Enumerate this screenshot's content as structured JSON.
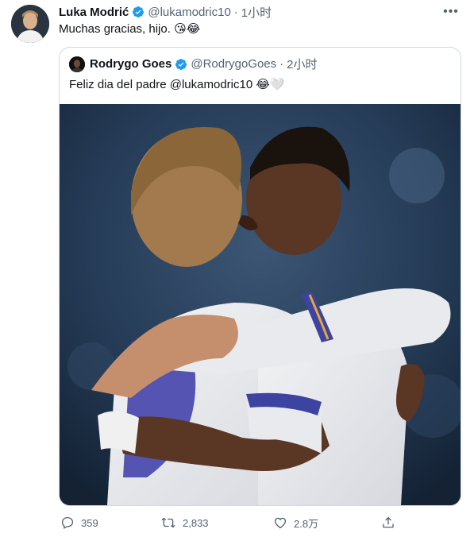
{
  "tweet": {
    "author_name": "Luka Modrić",
    "author_handle": "@lukamodric10",
    "separator": "·",
    "time": "1小时",
    "text": "Muchas gracias, hijo.",
    "emojis": "😘😂",
    "more_label": "•••"
  },
  "quote": {
    "author_name": "Rodrygo Goes",
    "author_handle": "@RodrygoGoes",
    "separator": "·",
    "time": "2小时",
    "text": "Feliz dia del padre @lukamodric10",
    "emojis": "😂🤍"
  },
  "actions": {
    "reply_count": "359",
    "retweet_count": "2,833",
    "like_count": "2.8万"
  },
  "colors": {
    "verified": "#1d9bf0",
    "muted": "#536471",
    "border": "#cfd9de"
  },
  "icons": [
    "verified-badge-icon",
    "more-icon",
    "reply-icon",
    "retweet-icon",
    "like-icon",
    "share-icon"
  ]
}
